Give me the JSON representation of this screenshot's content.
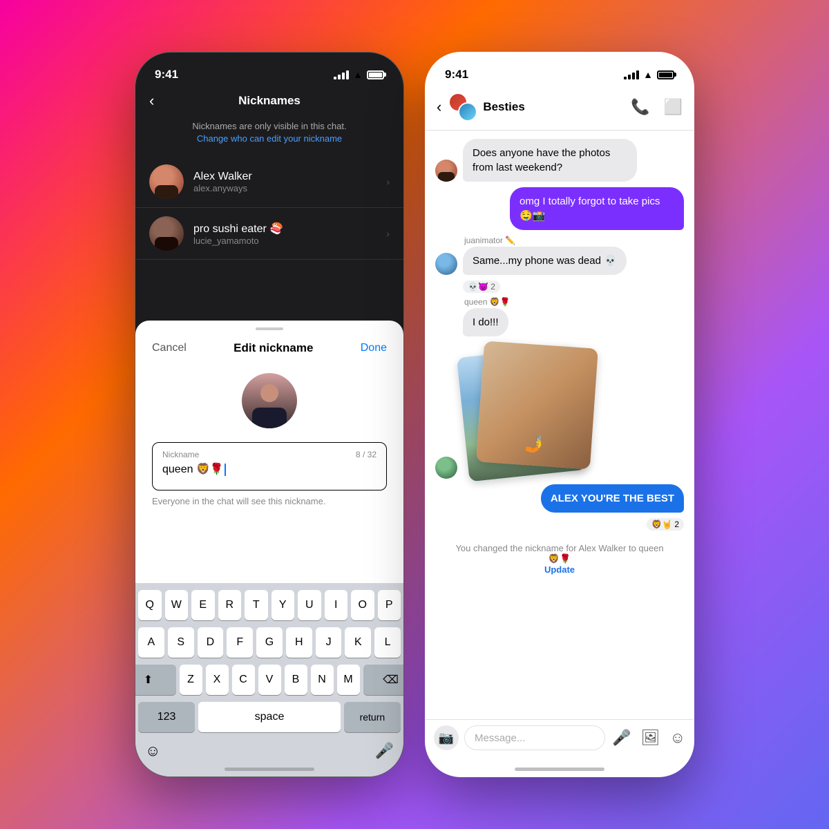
{
  "phone1": {
    "status_time": "9:41",
    "screen": "nicknames",
    "header": {
      "back_label": "‹",
      "title": "Nicknames"
    },
    "subtext": "Nicknames are only visible in this chat.",
    "subtext_link": "Change who can edit your nickname",
    "contacts": [
      {
        "name": "Alex Walker",
        "username": "alex.anyways",
        "avatar_style": "av-red"
      },
      {
        "name": "pro sushi eater 🍣",
        "username": "lucie_yamamoto",
        "avatar_style": "av-brown"
      }
    ],
    "sheet": {
      "cancel_label": "Cancel",
      "title": "Edit nickname",
      "done_label": "Done",
      "nickname_label": "Nickname",
      "nickname_value": "queen 🦁🌹",
      "char_count": "8 / 32",
      "hint": "Everyone in the chat will see this nickname."
    },
    "keyboard": {
      "rows": [
        [
          "Q",
          "W",
          "E",
          "R",
          "T",
          "Y",
          "U",
          "I",
          "O",
          "P"
        ],
        [
          "A",
          "S",
          "D",
          "F",
          "G",
          "H",
          "J",
          "K",
          "L"
        ],
        [
          "⬆",
          "Z",
          "X",
          "C",
          "V",
          "B",
          "N",
          "M",
          "⌫"
        ],
        [
          "123",
          "space",
          "return"
        ]
      ]
    }
  },
  "phone2": {
    "status_time": "9:41",
    "chat_name": "Besties",
    "messages": [
      {
        "type": "incoming",
        "text": "Does anyone have the photos from last weekend?",
        "avatar": "av-red"
      },
      {
        "type": "outgoing",
        "text": "omg I totally forgot to take pics 🤤📸",
        "style": "purple"
      },
      {
        "type": "name-label",
        "text": "juanimator ✏️"
      },
      {
        "type": "incoming",
        "text": "Same...my phone was dead 💀",
        "avatar": "av-blue",
        "reaction": "💀😈 2"
      },
      {
        "type": "name-label-left",
        "text": "queen 🦁🌹"
      },
      {
        "type": "incoming-text-only",
        "text": "I do!!!"
      },
      {
        "type": "photos",
        "avatar": "av-green"
      },
      {
        "type": "outgoing",
        "text": "ALEX YOU'RE THE BEST",
        "style": "blue",
        "reaction": "🦁🤘 2"
      }
    ],
    "system_message": "You changed the nickname for Alex Walker to queen 🦁🌹",
    "system_link": "Update",
    "input_placeholder": "Message...",
    "icons": {
      "back": "‹",
      "phone": "📞",
      "video": "⬜",
      "camera": "📷",
      "mic": "🎤",
      "gallery": "🖼",
      "sticker": "☺"
    }
  }
}
